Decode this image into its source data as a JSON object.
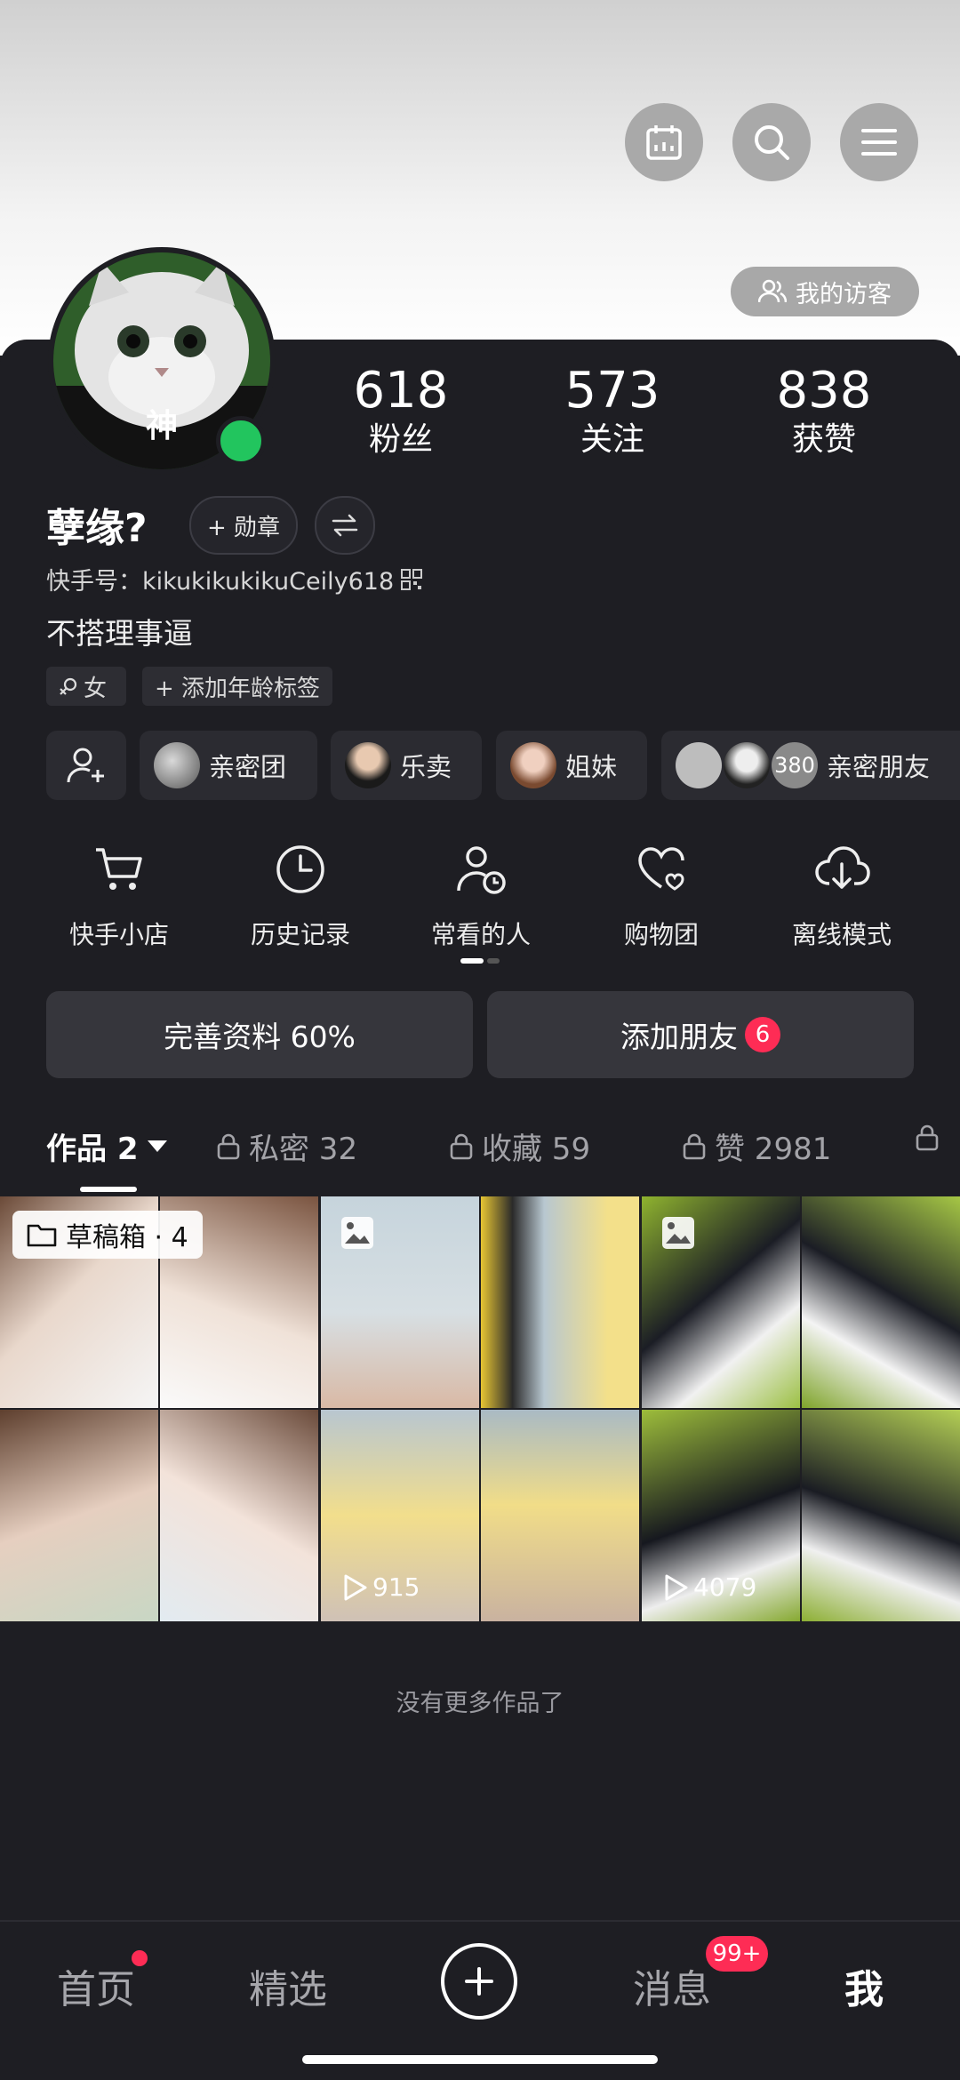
{
  "header": {
    "icons": [
      "calendar-icon",
      "search-icon",
      "menu-icon"
    ],
    "visitors_label": "我的访客"
  },
  "profile": {
    "avatar_text": "神",
    "online": true,
    "stats": [
      {
        "value": "618",
        "label": "粉丝"
      },
      {
        "value": "573",
        "label": "关注"
      },
      {
        "value": "838",
        "label": "获赞"
      }
    ],
    "name": "孽缘?",
    "medal_label": "+ 勋章",
    "uid": "快手号：kikukikukikuCeily618",
    "bio": "不搭理事逼",
    "tags": [
      "女",
      "+ 添加年龄标签"
    ]
  },
  "groups": [
    {
      "label": "亲密团"
    },
    {
      "label": "乐卖"
    },
    {
      "label": "姐妹"
    },
    {
      "label": "亲密朋友",
      "count": "380"
    }
  ],
  "functions": [
    {
      "label": "快手小店",
      "icon": "cart-icon"
    },
    {
      "label": "历史记录",
      "icon": "clock-icon"
    },
    {
      "label": "常看的人",
      "icon": "person-clock-icon"
    },
    {
      "label": "购物团",
      "icon": "heart-group-icon"
    },
    {
      "label": "离线模式",
      "icon": "cloud-download-icon"
    }
  ],
  "actions": {
    "complete_profile": "完善资料 60%",
    "add_friends": "添加朋友",
    "add_friends_badge": "6"
  },
  "tabs": [
    {
      "label": "作品 2",
      "active": true
    },
    {
      "label": "私密 32",
      "locked": true
    },
    {
      "label": "收藏 59",
      "locked": true
    },
    {
      "label": "赞 2981",
      "locked": true
    }
  ],
  "works": [
    {
      "label": "草稿箱 · 4",
      "type": "draft"
    },
    {
      "plays": "915",
      "type": "video"
    },
    {
      "plays": "4079",
      "type": "video"
    }
  ],
  "no_more": "没有更多作品了",
  "nav": {
    "home": "首页",
    "featured": "精选",
    "messages": "消息",
    "messages_badge": "99+",
    "me": "我"
  },
  "colors": {
    "accent": "#fe2c55",
    "online": "#22c55e",
    "background": "#1e1e23"
  }
}
